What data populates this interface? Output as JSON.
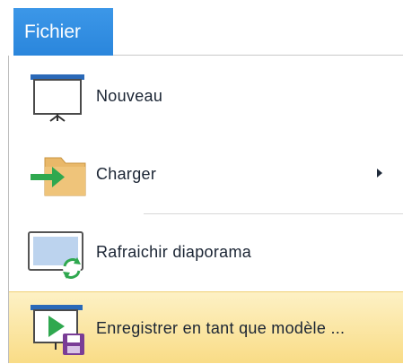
{
  "menubar": {
    "file_tab_label": "Fichier"
  },
  "menu": {
    "items": [
      {
        "label": "Nouveau",
        "icon": "new-presentation-icon",
        "submenu": false
      },
      {
        "label": "Charger",
        "icon": "load-folder-icon",
        "submenu": true
      },
      {
        "label": "Rafraichir diaporama",
        "icon": "refresh-slideshow-icon",
        "submenu": false
      },
      {
        "label": "Enregistrer en tant que modèle ...",
        "icon": "save-as-template-icon",
        "submenu": false,
        "highlighted": true
      }
    ]
  },
  "colors": {
    "file_tab_bg": "#2a86dc",
    "highlight_bg": "#f9dc86",
    "arrow_green": "#2fa84f",
    "screen_blue": "#1f5fb0"
  }
}
